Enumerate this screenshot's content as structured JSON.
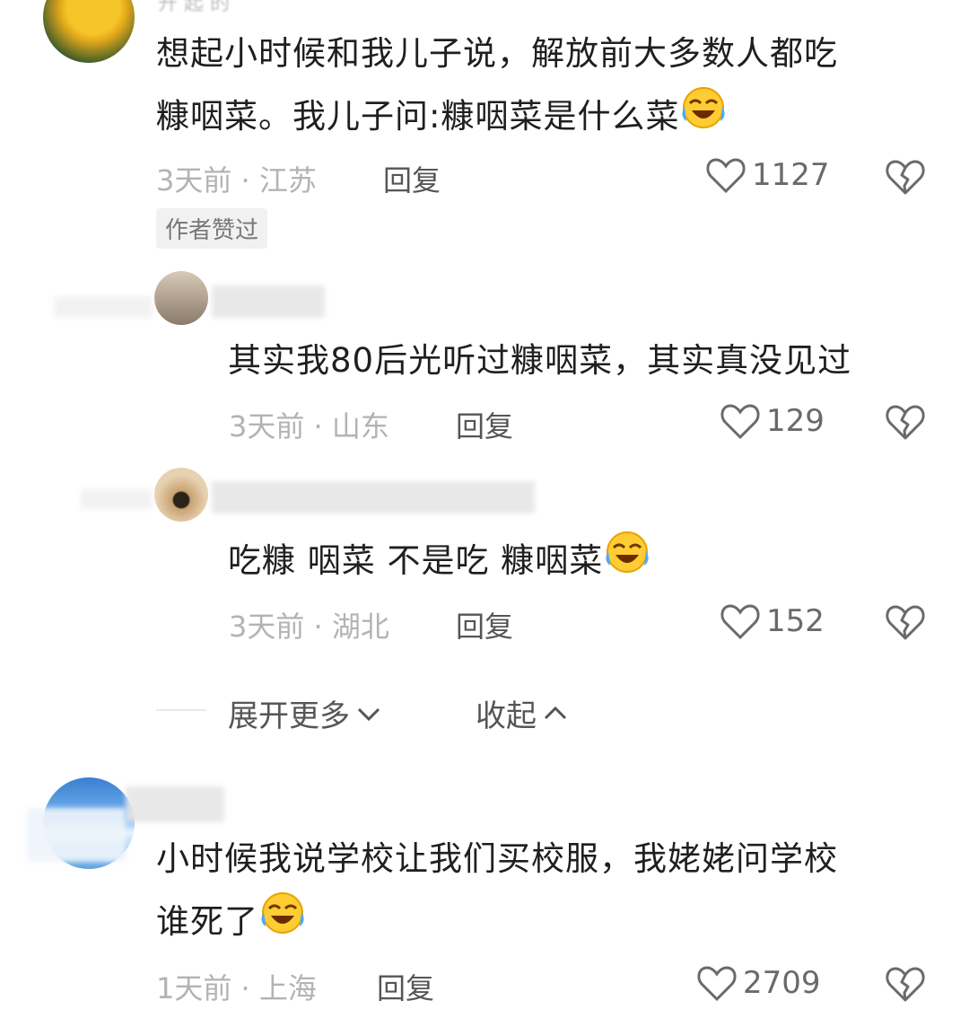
{
  "comments": [
    {
      "text_line1": "想起小时候和我儿子说，解放前大多数人都吃",
      "text_line2": "糠咽菜。我儿子问:糠咽菜是什么菜",
      "emoji": "laughing-tears-emoji",
      "meta": "3天前 · 江苏",
      "reply": "回复",
      "likes": "1127",
      "badge": "作者赞过"
    },
    {
      "text": "其实我80后光听过糠咽菜，其实真没见过",
      "meta": "3天前 · 山东",
      "reply": "回复",
      "likes": "129"
    },
    {
      "text": "吃糠 咽菜 不是吃 糠咽菜",
      "emoji": "laughing-tears-emoji",
      "meta": "3天前 · 湖北",
      "reply": "回复",
      "likes": "152"
    },
    {
      "text_line1": "小时候我说学校让我们买校服，我姥姥问学校",
      "text_line2": "谁死了",
      "emoji": "laughing-tears-emoji",
      "meta": "1天前 · 上海",
      "reply": "回复",
      "likes": "2709"
    }
  ],
  "thread_controls": {
    "expand": "展开更多",
    "collapse": "收起"
  },
  "colors": {
    "text": "#1f1f1f",
    "meta": "#b3b3b3",
    "icon": "#6a6a6a"
  }
}
